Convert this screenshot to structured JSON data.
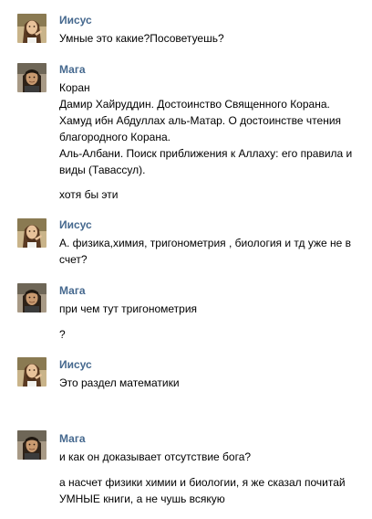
{
  "messages": [
    {
      "author": "Иисус",
      "avatar": "jesus-avatar",
      "lines": [
        "Умные это какие?Посоветуешь?"
      ]
    },
    {
      "author": "Мага",
      "avatar": "maga-avatar",
      "lines": [
        "Коран",
        "Дамир Хайруддин. Достоинство Священного Корана.",
        "Хамуд ибн Абдуллах аль-Матар. О достоинстве чтения",
        "благородного Корана.",
        "Аль-Албани. Поиск приближения к Аллаху: его правила и",
        "виды (Тавассул).",
        "хотя бы эти"
      ]
    },
    {
      "author": "Иисус",
      "avatar": "jesus-avatar",
      "lines": [
        "А. физика,химия, тригонометрия , биология и тд уже не в",
        "счет?"
      ]
    },
    {
      "author": "Мага",
      "avatar": "maga-avatar",
      "lines": [
        "при чем тут тригонометрия",
        "?"
      ]
    },
    {
      "author": "Иисус",
      "avatar": "jesus-avatar",
      "lines": [
        "Это раздел математики"
      ]
    },
    {
      "author": "Мага",
      "avatar": "maga-avatar",
      "lines": [
        "и как он доказывает отсутствие бога?",
        "а насчет физики химии и биологии, я же сказал почитай",
        "УМНЫЕ книги, а не чушь всякую"
      ]
    }
  ]
}
